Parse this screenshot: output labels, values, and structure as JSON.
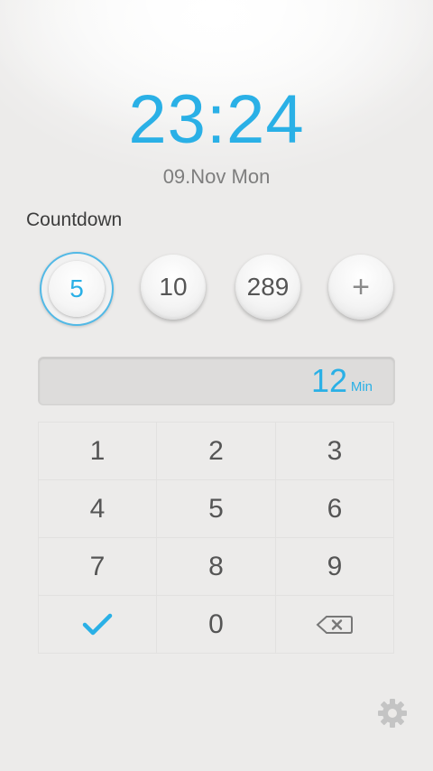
{
  "clock": {
    "time": "23:24",
    "date": "09.Nov Mon"
  },
  "countdown": {
    "label": "Countdown",
    "presets": [
      "5",
      "10",
      "289"
    ],
    "add_label": "+"
  },
  "display": {
    "value": "12",
    "unit": "Min"
  },
  "keypad": {
    "keys": [
      "1",
      "2",
      "3",
      "4",
      "5",
      "6",
      "7",
      "8",
      "9"
    ],
    "zero": "0"
  },
  "icons": {
    "confirm": "check-icon",
    "backspace": "backspace-icon",
    "settings": "gear-icon"
  },
  "colors": {
    "accent": "#2ab0e6",
    "text": "#555555",
    "background": "#eceae8"
  }
}
